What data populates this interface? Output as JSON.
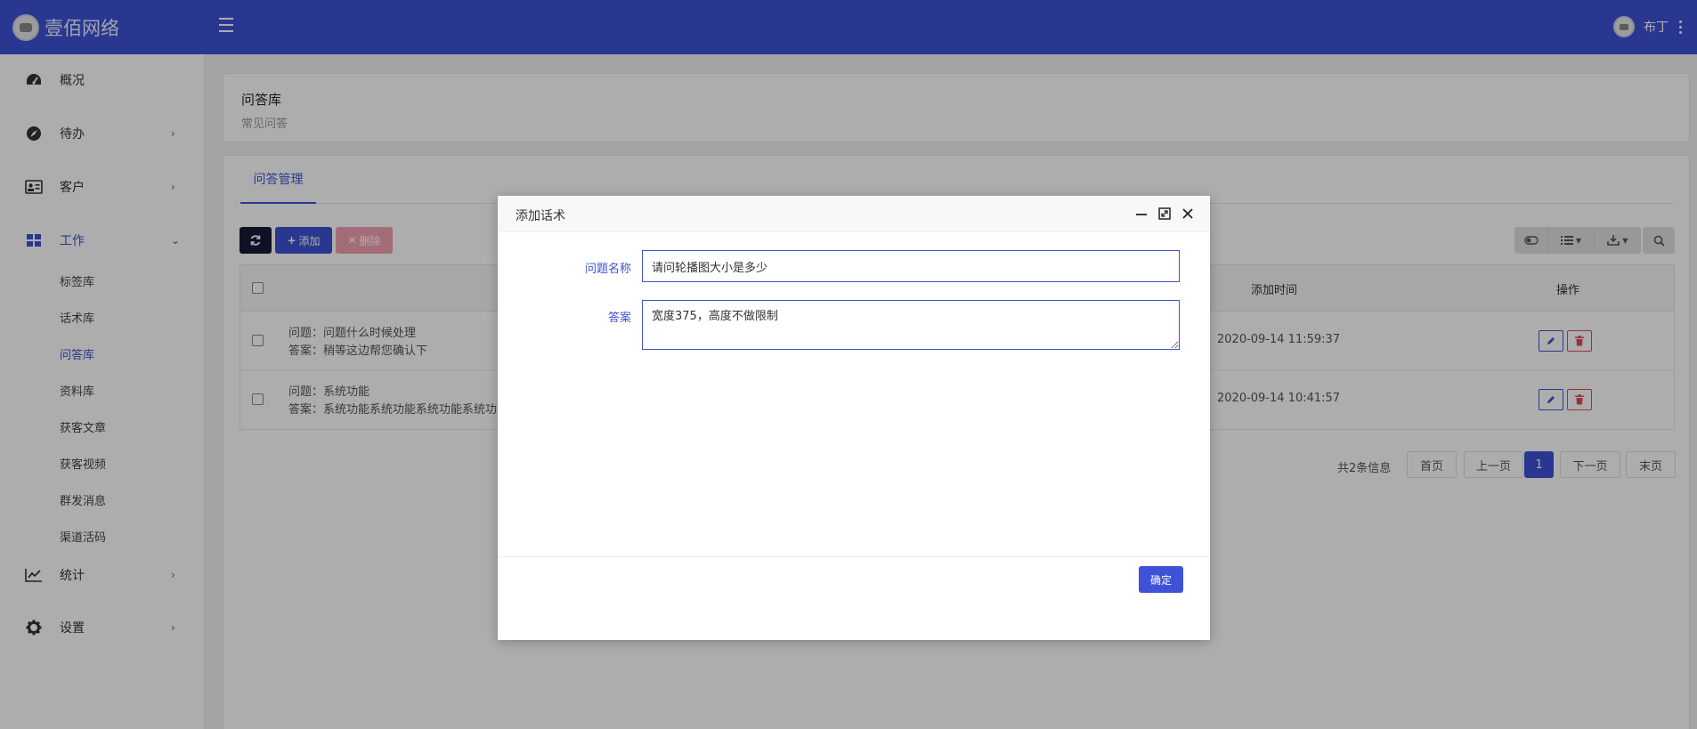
{
  "brand": {
    "name": "壹佰网络"
  },
  "user": {
    "name": "布丁"
  },
  "sidebar": {
    "items": [
      {
        "label": "概况",
        "icon": "dashboard-icon"
      },
      {
        "label": "待办",
        "icon": "compass-icon",
        "chevron": "›"
      },
      {
        "label": "客户",
        "icon": "id-card-icon",
        "chevron": "›"
      },
      {
        "label": "工作",
        "icon": "grid-icon",
        "chevron": "⌄"
      },
      {
        "label": "统计",
        "icon": "line-chart-icon",
        "chevron": "›"
      },
      {
        "label": "设置",
        "icon": "gear-icon",
        "chevron": "›"
      }
    ],
    "sub_items": [
      "标签库",
      "话术库",
      "问答库",
      "资料库",
      "获客文章",
      "获客视频",
      "群发消息",
      "渠道活码"
    ]
  },
  "page": {
    "title": "问答库",
    "subtitle": "常见问答"
  },
  "tabs": [
    {
      "label": "问答管理"
    }
  ],
  "toolbar": {
    "add_label": "添加",
    "delete_label": "删除"
  },
  "table": {
    "headers": {
      "time": "添加时间",
      "action": "操作"
    },
    "rows": [
      {
        "question": "问题：问题什么时候处理",
        "answer": "答案：稍等这边帮您确认下",
        "time": "2020-09-14 11:59:37"
      },
      {
        "question": "问题：系统功能",
        "answer": "答案：系统功能系统功能系统功能系统功",
        "time": "2020-09-14 10:41:57"
      }
    ]
  },
  "pagination": {
    "info": "共2条信息",
    "first": "首页",
    "prev": "上一页",
    "current": "1",
    "next": "下一页",
    "last": "末页"
  },
  "modal": {
    "title": "添加话术",
    "fields": {
      "question_label": "问题名称",
      "question_value": "请问轮播图大小是多少",
      "answer_label": "答案",
      "answer_value": "宽度375，高度不做限制"
    },
    "confirm_label": "确定"
  },
  "colors": {
    "primary": "#3f51d6",
    "danger": "#e24b5b",
    "dark": "#151b36"
  }
}
